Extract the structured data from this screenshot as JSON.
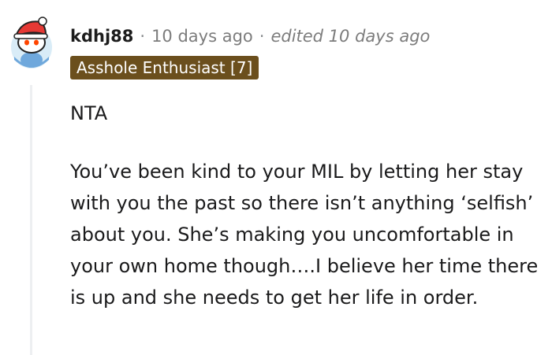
{
  "comment": {
    "username": "kdhj88",
    "separator": "·",
    "timestamp": "10 days ago",
    "edited": "edited 10 days ago",
    "flair": "Asshole Enthusiast [7]",
    "avatar_icon": "reddit-snoo-avatar-icon",
    "body": [
      "NTA",
      "You’ve been kind to your MIL by letting her stay with you the past so there isn’t anything ‘selfish’ about you. She’s making you uncomfortable in your own home though….I believe her time there is up and she needs to get her life in order."
    ]
  },
  "colors": {
    "flair_bg": "#6b4f1d",
    "flair_text": "#ffffff",
    "username": "#1c1c1c",
    "meta_text": "#7c7c7c",
    "thread_line": "#edeff1",
    "avatar_bg": "#6fa8dc",
    "avatar_hat": "#e53935"
  }
}
